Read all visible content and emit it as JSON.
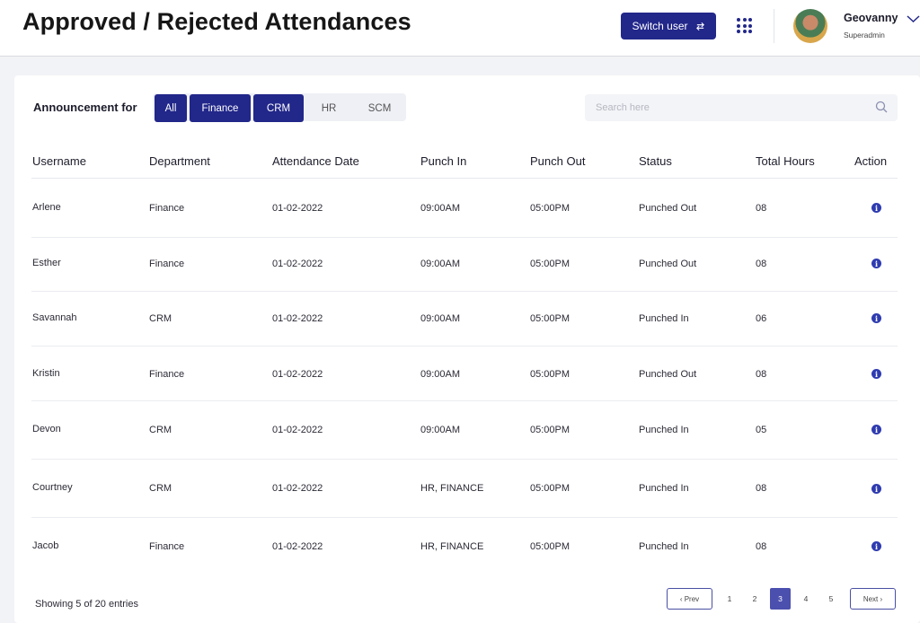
{
  "header": {
    "title": "Approved / Rejected Attendances",
    "switch_user_label": "Switch user",
    "user": {
      "name": "Geovanny",
      "role": "Superadmin"
    }
  },
  "filters": {
    "label": "Announcement for",
    "options": [
      {
        "label": "All",
        "active": true
      },
      {
        "label": "Finance",
        "active": true
      },
      {
        "label": "CRM",
        "active": true
      },
      {
        "label": "HR",
        "active": false
      },
      {
        "label": "SCM",
        "active": false
      }
    ]
  },
  "search": {
    "placeholder": "Search here"
  },
  "table": {
    "columns": [
      "Username",
      "Department",
      "Attendance Date",
      "Punch In",
      "Punch Out",
      "Status",
      "Total Hours",
      "Action"
    ],
    "rows": [
      {
        "username": "Arlene",
        "department": "Finance",
        "date": "01-02-2022",
        "punch_in": "09:00AM",
        "punch_out": "05:00PM",
        "status": "Punched Out",
        "hours": "08"
      },
      {
        "username": "Esther",
        "department": "Finance",
        "date": "01-02-2022",
        "punch_in": "09:00AM",
        "punch_out": "05:00PM",
        "status": "Punched Out",
        "hours": "08"
      },
      {
        "username": "Savannah",
        "department": "CRM",
        "date": "01-02-2022",
        "punch_in": "09:00AM",
        "punch_out": "05:00PM",
        "status": "Punched In",
        "hours": "06"
      },
      {
        "username": "Kristin",
        "department": "Finance",
        "date": "01-02-2022",
        "punch_in": "09:00AM",
        "punch_out": "05:00PM",
        "status": "Punched Out",
        "hours": "08"
      },
      {
        "username": "Devon",
        "department": "CRM",
        "date": "01-02-2022",
        "punch_in": "09:00AM",
        "punch_out": "05:00PM",
        "status": "Punched In",
        "hours": "05"
      },
      {
        "username": "Courtney",
        "department": "CRM",
        "date": "01-02-2022",
        "punch_in": "HR, FINANCE",
        "punch_out": "05:00PM",
        "status": "Punched In",
        "hours": "08"
      },
      {
        "username": "Jacob",
        "department": "Finance",
        "date": "01-02-2022",
        "punch_in": "HR, FINANCE",
        "punch_out": "05:00PM",
        "status": "Punched In",
        "hours": "08"
      }
    ]
  },
  "footer": {
    "showing": "Showing 5 of 20 entries"
  },
  "pagination": {
    "prev_label": "‹ Prev",
    "next_label": "Next ›",
    "pages": [
      "1",
      "2",
      "3",
      "4",
      "5"
    ],
    "current": "3"
  },
  "colors": {
    "primary": "#22278a",
    "active_page": "#4b4fae",
    "info_icon": "#2f3bb0"
  }
}
